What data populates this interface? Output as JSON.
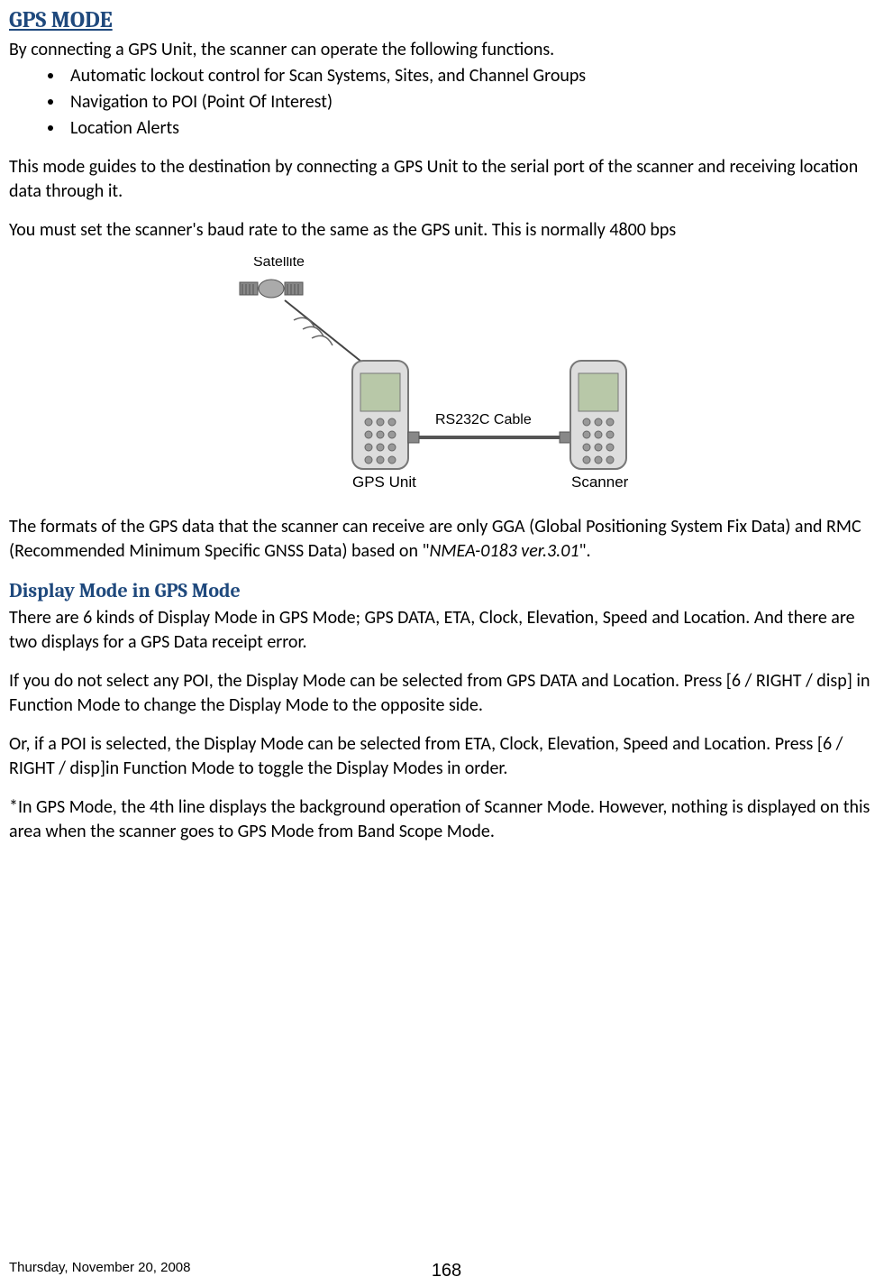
{
  "title": "GPS MODE",
  "intro": "By connecting a GPS Unit, the scanner can operate the following functions.",
  "bullets": [
    "Automatic lockout control for Scan Systems, Sites, and Channel Groups",
    "Navigation to POI (Point Of Interest)",
    "Location Alerts"
  ],
  "para1": "This mode guides to the destination by connecting a GPS Unit to the serial port of the scanner and receiving location data through it.",
  "para2": "You must set the scanner's baud rate to the same as the GPS unit. This is normally 4800 bps",
  "diagram": {
    "satellite_label": "Satellite",
    "gps_label": "GPS Unit",
    "scanner_label": "Scanner",
    "cable_label": "RS232C Cable"
  },
  "para3_a": "The formats of the GPS data that the scanner can receive are only GGA (Global Positioning System Fix Data) and RMC (Recommended Minimum Specific GNSS Data) based on \"",
  "para3_em": "NMEA-0183 ver.3.01",
  "para3_b": "\".",
  "subheading": "Display Mode in GPS Mode",
  "para4": "There are 6 kinds of Display Mode in GPS Mode; GPS DATA, ETA, Clock, Elevation, Speed and Location. And there are two displays for a GPS Data receipt error.",
  "para5": "If you do not select any POI, the Display Mode can be selected from GPS DATA and Location. Press [6 / RIGHT / disp] in Function Mode to change the Display Mode to the opposite side.",
  "para6": "Or, if a POI is selected, the Display Mode can be selected from ETA, Clock, Elevation, Speed and Location. Press [6 / RIGHT / disp]in Function Mode to toggle the Display Modes in order.",
  "para7": "*In GPS Mode, the 4th line displays the background operation of Scanner Mode. However, nothing is displayed on this area when the scanner goes to GPS Mode from Band Scope Mode.",
  "footer": {
    "date": "Thursday, November 20, 2008",
    "page": "168"
  }
}
